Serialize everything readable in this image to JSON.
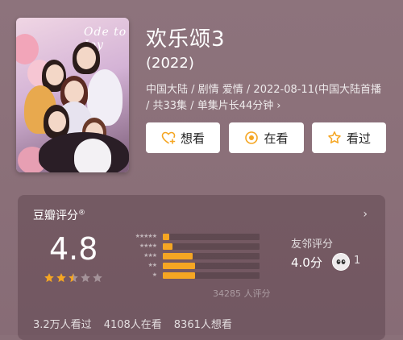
{
  "movie": {
    "title": "欢乐颂3",
    "year": "(2022)",
    "meta": "中国大陆 / 剧情 爱情 / 2022-08-11(中国大陆首播 / 共33集 / 单集片长44分钟",
    "meta_arrow": "›",
    "poster_logo": "Ode to Joy"
  },
  "actions": {
    "want": "想看",
    "watching": "在看",
    "watched": "看过"
  },
  "rating": {
    "section_title": "豆瓣评分",
    "registered": "®",
    "chevron": "›",
    "score": "4.8",
    "stars_value": 2.5,
    "stars_max": 5,
    "distribution": [
      {
        "stars": "★★★★★",
        "fraction": 0.07
      },
      {
        "stars": "★★★★",
        "fraction": 0.1
      },
      {
        "stars": "★★★",
        "fraction": 0.31
      },
      {
        "stars": "★★",
        "fraction": 0.33
      },
      {
        "stars": "★",
        "fraction": 0.33
      }
    ],
    "count": "34285 人评分",
    "friend_label": "友邻评分",
    "friend_score": "4.0分",
    "friend_count": "1"
  },
  "stats": {
    "watched": "3.2万人看过",
    "watching": "4108人在看",
    "want": "8361人想看"
  },
  "colors": {
    "accent": "#f5a623",
    "background": "#8a7079"
  }
}
